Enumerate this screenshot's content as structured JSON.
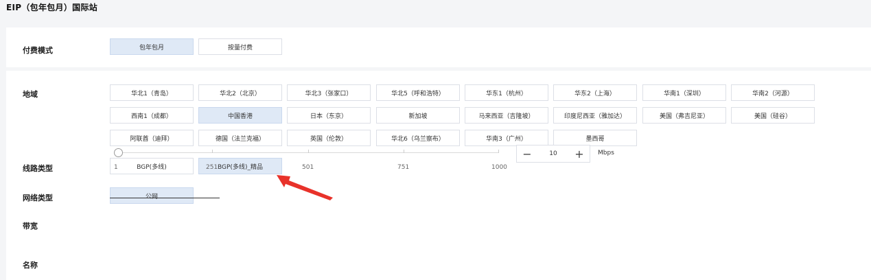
{
  "page": {
    "title": "EIP（包年包月）国际站"
  },
  "billing": {
    "label": "付费模式",
    "options": [
      {
        "label": "包年包月",
        "selected": true
      },
      {
        "label": "按量付费",
        "selected": false
      }
    ]
  },
  "region": {
    "label": "地域",
    "options": [
      "华北1（青岛）",
      "华北2（北京）",
      "华北3（张家口）",
      "华北5（呼和浩特）",
      "华东1（杭州）",
      "华东2（上海）",
      "华南1（深圳）",
      "华南2（河源）",
      "西南1（成都）",
      "中国香港",
      "日本（东京）",
      "新加坡",
      "马来西亚（吉隆坡）",
      "印度尼西亚（雅加达）",
      "美国（弗吉尼亚）",
      "美国（硅谷）",
      "阿联酋（迪拜）",
      "德国（法兰克福）",
      "英国（伦敦）",
      "华北6（乌兰察布）",
      "华南3（广州）",
      "墨西哥"
    ],
    "selected": "中国香港"
  },
  "line_type": {
    "label": "线路类型",
    "options": [
      {
        "label": "BGP(多线)",
        "selected": false
      },
      {
        "label": "BGP(多线)_精品",
        "selected": true
      }
    ]
  },
  "network_type": {
    "label": "网络类型",
    "options": [
      {
        "label": "公网",
        "selected": true
      }
    ]
  },
  "bandwidth": {
    "label": "带宽",
    "ticks": [
      "1",
      "251",
      "501",
      "751",
      "1000"
    ],
    "min": 1,
    "max": 1000,
    "value": "10",
    "unit": "Mbps",
    "minus": "−",
    "plus": "+"
  },
  "name": {
    "label": "名称",
    "value": ""
  },
  "colors": {
    "selected_bg": "#dfe9f6",
    "arrow": "#e8322a"
  }
}
